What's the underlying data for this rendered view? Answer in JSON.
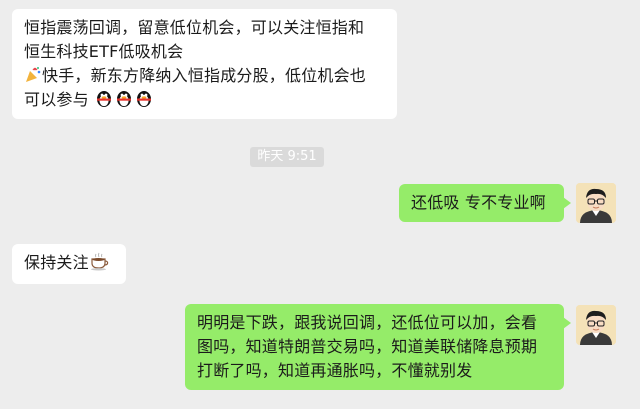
{
  "chat": {
    "messages": [
      {
        "sender": "other",
        "lines": [
          "恒指震荡回调，留意低位机会，可以关注恒指和",
          "恒生科技ETF低吸机会",
          "快手，新东方降纳入恒指成分股，低位机会也",
          "可以参与"
        ],
        "emojis": [
          "party-popper-emoji",
          "penguin-emoji",
          "penguin-emoji",
          "penguin-emoji"
        ]
      },
      {
        "sender": "timestamp",
        "text": "昨天 9:51"
      },
      {
        "sender": "me",
        "lines": [
          "还低吸 专不专业啊"
        ]
      },
      {
        "sender": "other",
        "lines": [
          "保持关注"
        ],
        "emojis": [
          "coffee-emoji"
        ]
      },
      {
        "sender": "me",
        "lines": [
          "明明是下跌，跟我说回调，还低位可以加，会看",
          "图吗，知道特朗普交易吗，知道美联储降息预期",
          "打断了吗，知道再通胀吗，不懂就别发"
        ]
      }
    ]
  },
  "colors": {
    "background": "#ededed",
    "incoming_bubble": "#ffffff",
    "outgoing_bubble": "#95ec69",
    "timestamp_bg": "#dadada"
  }
}
